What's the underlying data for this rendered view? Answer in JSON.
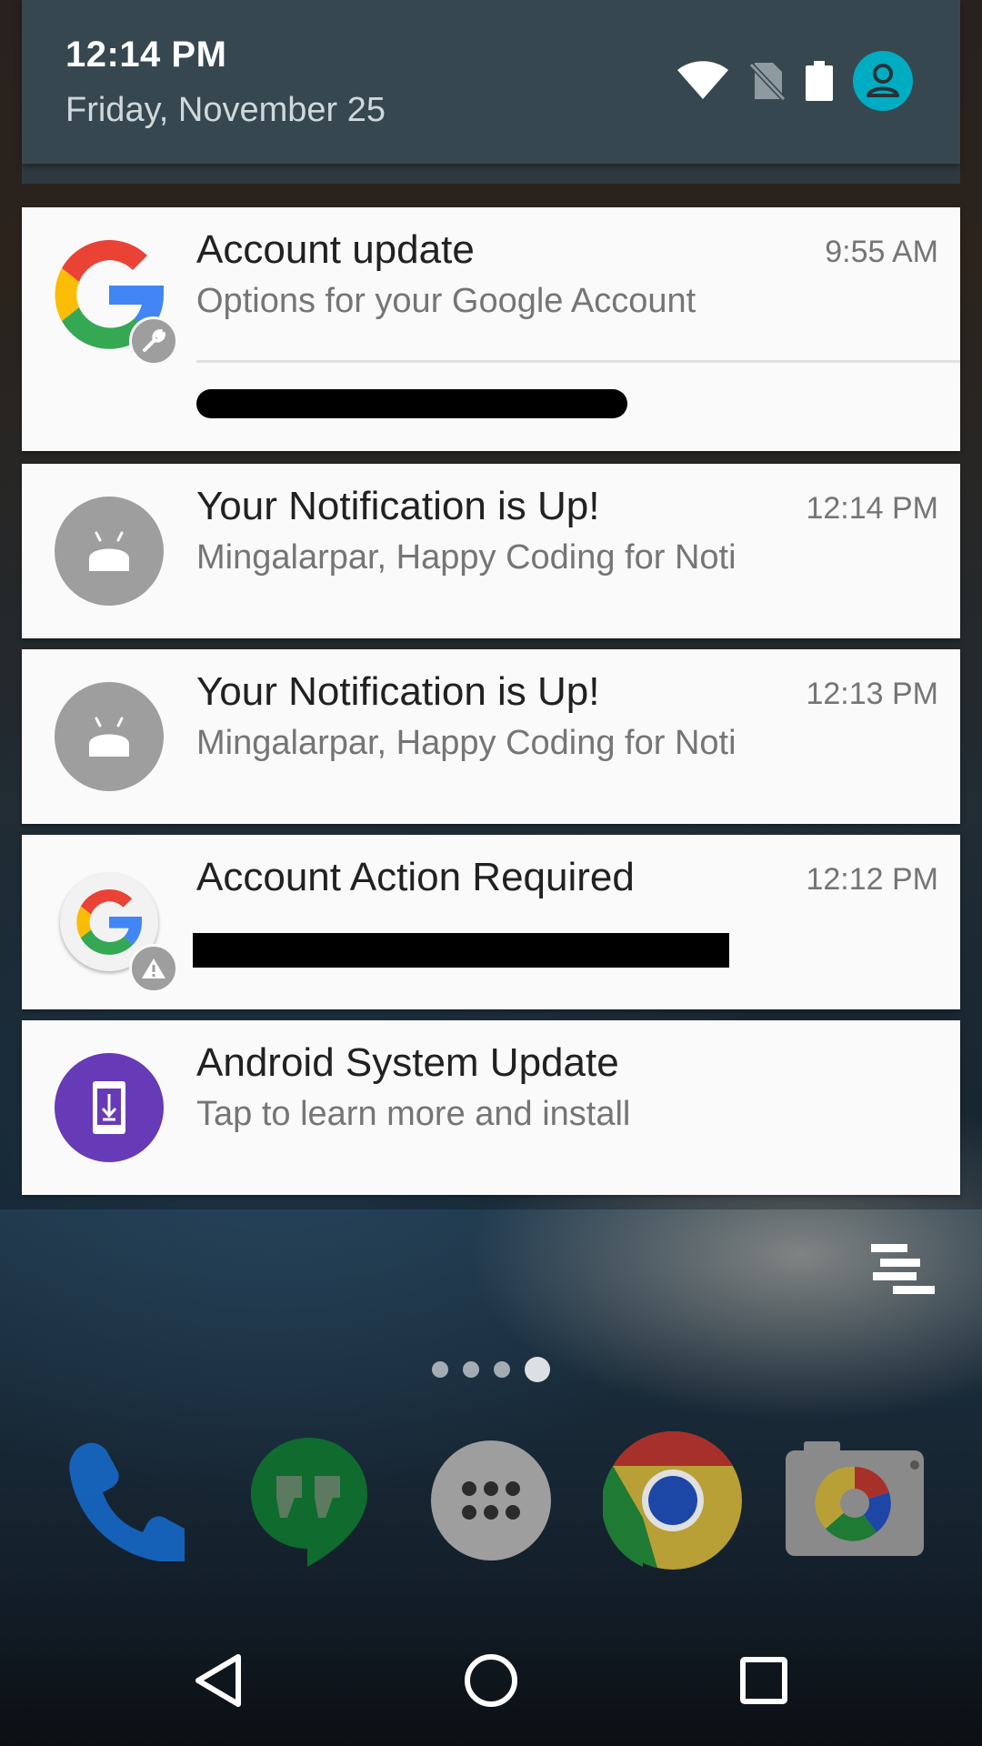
{
  "status": {
    "time": "12:14 PM",
    "date": "Friday, November 25",
    "icons": [
      "wifi-icon",
      "no-sim-icon",
      "battery-icon",
      "account-avatar-icon"
    ]
  },
  "notifications": [
    {
      "app_icon": "google-g-icon",
      "badge_icon": "wrench-icon",
      "title": "Account update",
      "time": "9:55 AM",
      "text": "Options for your Google Account",
      "redacted": true
    },
    {
      "app_icon": "android-icon",
      "title": "Your Notification is Up!",
      "time": "12:14 PM",
      "text": "Mingalarpar, Happy Coding for Noti"
    },
    {
      "app_icon": "android-icon",
      "title": "Your Notification is Up!",
      "time": "12:13 PM",
      "text": "Mingalarpar, Happy Coding for Noti"
    },
    {
      "app_icon": "google-g-icon",
      "badge_icon": "warning-icon",
      "title": "Account Action Required",
      "time": "12:12 PM",
      "text": "",
      "redacted": true
    },
    {
      "app_icon": "system-update-icon",
      "title": "Android System Update",
      "time": "",
      "text": "Tap to learn more and install"
    }
  ],
  "colors": {
    "qs_header": "#37474f",
    "card_bg": "#fafafa",
    "avatar": "#00acc1",
    "system_update": "#673ab7",
    "android_icon_bg": "#9e9e9e"
  },
  "home": {
    "page_count": 4,
    "active_page": 4,
    "dock": [
      "phone-icon",
      "hangouts-icon",
      "app-drawer-icon",
      "chrome-icon",
      "camera-icon"
    ]
  },
  "navbar": [
    "back-icon",
    "home-icon",
    "recents-icon"
  ]
}
